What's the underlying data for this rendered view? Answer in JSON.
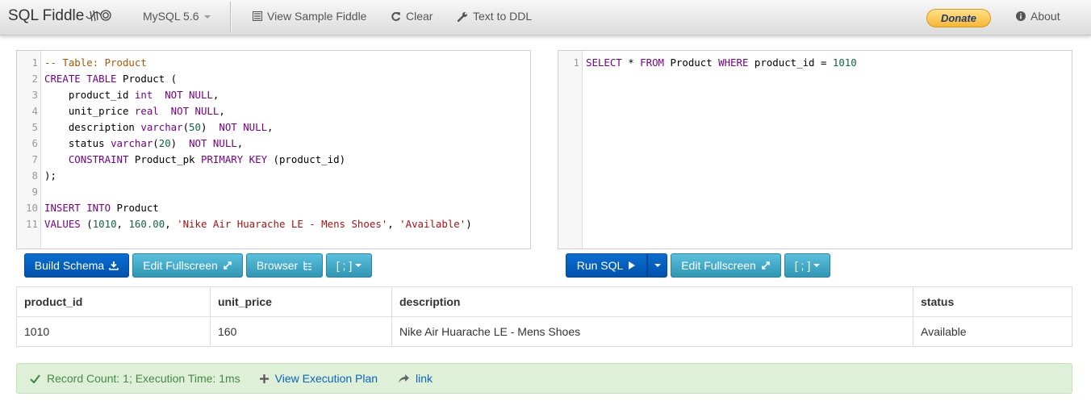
{
  "navbar": {
    "brand": "SQL Fiddle",
    "db_version": "MySQL 5.6",
    "view_sample": "View Sample Fiddle",
    "clear": "Clear",
    "text_to_ddl": "Text to DDL",
    "donate": "Donate",
    "about": "About"
  },
  "schema_panel": {
    "build_schema": "Build Schema",
    "edit_fullscreen": "Edit Fullscreen",
    "browser": "Browser",
    "terminator": "[ ; ]"
  },
  "query_panel": {
    "run_sql": "Run SQL",
    "edit_fullscreen": "Edit Fullscreen",
    "terminator": "[ ; ]"
  },
  "results": {
    "columns": [
      "product_id",
      "unit_price",
      "description",
      "status"
    ],
    "rows": [
      [
        "1010",
        "160",
        "Nike Air Huarache LE - Mens Shoes",
        "Available"
      ]
    ]
  },
  "status_bar": {
    "message": "Record Count: 1; Execution Time: 1ms",
    "view_plan": "View Execution Plan",
    "link": "link"
  },
  "colors": {
    "primary": "#0152ad",
    "info": "#2f96b4",
    "success_bg": "#dff0d8",
    "success_text": "#468847",
    "link": "#0a64b8"
  }
}
